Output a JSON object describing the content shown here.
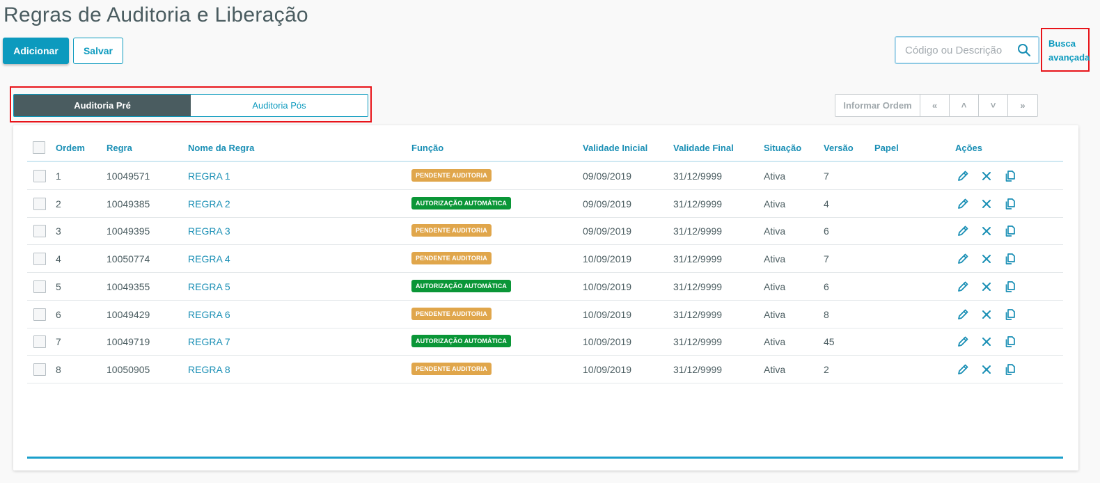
{
  "page": {
    "title": "Regras de Auditoria e Liberação"
  },
  "toolbar": {
    "add_label": "Adicionar",
    "save_label": "Salvar"
  },
  "search": {
    "placeholder": "Código ou Descrição",
    "value": ""
  },
  "advanced_search": {
    "label_line1": "Busca",
    "label_line2": "avançada"
  },
  "tabs": [
    {
      "label": "Auditoria Pré",
      "active": true
    },
    {
      "label": "Auditoria Pós",
      "active": false
    }
  ],
  "order_controls": {
    "label": "Informar Ordem",
    "first": "«",
    "up": "˄",
    "down": "˅",
    "last": "»"
  },
  "table": {
    "columns": [
      "Ordem",
      "Regra",
      "Nome da Regra",
      "Função",
      "Validade Inicial",
      "Validade Final",
      "Situação",
      "Versão",
      "Papel",
      "Ações"
    ],
    "rows": [
      {
        "ordem": "1",
        "regra": "10049571",
        "nome": "REGRA 1",
        "funcao": "PENDENTE AUDITORIA",
        "funcao_type": "pend",
        "inicio": "09/09/2019",
        "fim": "31/12/9999",
        "situacao": "Ativa",
        "versao": "7",
        "papel": ""
      },
      {
        "ordem": "2",
        "regra": "10049385",
        "nome": "REGRA 2",
        "funcao": "AUTORIZAÇÃO AUTOMÁTICA",
        "funcao_type": "auto",
        "inicio": "09/09/2019",
        "fim": "31/12/9999",
        "situacao": "Ativa",
        "versao": "4",
        "papel": ""
      },
      {
        "ordem": "3",
        "regra": "10049395",
        "nome": "REGRA 3",
        "funcao": "PENDENTE AUDITORIA",
        "funcao_type": "pend",
        "inicio": "09/09/2019",
        "fim": "31/12/9999",
        "situacao": "Ativa",
        "versao": "6",
        "papel": ""
      },
      {
        "ordem": "4",
        "regra": "10050774",
        "nome": "REGRA 4",
        "funcao": "PENDENTE AUDITORIA",
        "funcao_type": "pend",
        "inicio": "10/09/2019",
        "fim": "31/12/9999",
        "situacao": "Ativa",
        "versao": "7",
        "papel": ""
      },
      {
        "ordem": "5",
        "regra": "10049355",
        "nome": "REGRA 5",
        "funcao": "AUTORIZAÇÃO AUTOMÁTICA",
        "funcao_type": "auto",
        "inicio": "10/09/2019",
        "fim": "31/12/9999",
        "situacao": "Ativa",
        "versao": "6",
        "papel": ""
      },
      {
        "ordem": "6",
        "regra": "10049429",
        "nome": "REGRA 6",
        "funcao": "PENDENTE AUDITORIA",
        "funcao_type": "pend",
        "inicio": "10/09/2019",
        "fim": "31/12/9999",
        "situacao": "Ativa",
        "versao": "8",
        "papel": ""
      },
      {
        "ordem": "7",
        "regra": "10049719",
        "nome": "REGRA 7",
        "funcao": "AUTORIZAÇÃO AUTOMÁTICA",
        "funcao_type": "auto",
        "inicio": "10/09/2019",
        "fim": "31/12/9999",
        "situacao": "Ativa",
        "versao": "45",
        "papel": ""
      },
      {
        "ordem": "8",
        "regra": "10050905",
        "nome": "REGRA 8",
        "funcao": "PENDENTE AUDITORIA",
        "funcao_type": "pend",
        "inicio": "10/09/2019",
        "fim": "31/12/9999",
        "situacao": "Ativa",
        "versao": "2",
        "papel": ""
      }
    ],
    "row_actions": [
      "pencil-icon",
      "close-icon",
      "copy-icon"
    ]
  },
  "colors": {
    "accent": "#0c9abe",
    "tab_active": "#4a5c60",
    "pending": "#e0a64b",
    "automatic": "#0a9637",
    "highlight": "#e8141a"
  }
}
